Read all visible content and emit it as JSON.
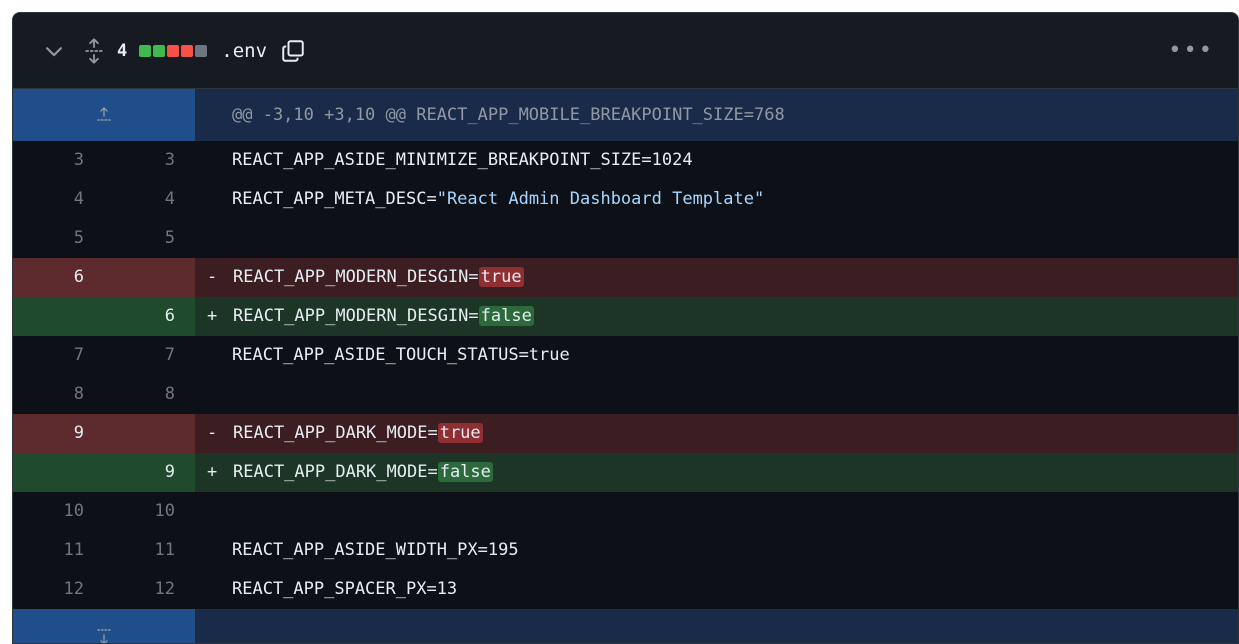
{
  "header": {
    "changes_count": "4",
    "filename": ".env",
    "more_label": "•••",
    "bars": [
      "#3fb950",
      "#3fb950",
      "#f85149",
      "#f85149",
      "#6e7681"
    ]
  },
  "hunk_top": {
    "text": "@@ -3,10 +3,10 @@ REACT_APP_MOBILE_BREAKPOINT_SIZE=768"
  },
  "lines": [
    {
      "type": "ctx",
      "old": "3",
      "new": "3",
      "text": "REACT_APP_ASIDE_MINIMIZE_BREAKPOINT_SIZE=1024"
    },
    {
      "type": "ctx",
      "old": "4",
      "new": "4",
      "text_prefix": "REACT_APP_META_DESC=",
      "text_string": "\"React Admin Dashboard Template\""
    },
    {
      "type": "ctx",
      "old": "5",
      "new": "5",
      "text": ""
    },
    {
      "type": "del",
      "old": "6",
      "new": "",
      "marker": "-",
      "text_prefix": "REACT_APP_MODERN_DESGIN=",
      "text_hl": "true"
    },
    {
      "type": "add",
      "old": "",
      "new": "6",
      "marker": "+",
      "text_prefix": "REACT_APP_MODERN_DESGIN=",
      "text_hl": "false"
    },
    {
      "type": "ctx",
      "old": "7",
      "new": "7",
      "text": "REACT_APP_ASIDE_TOUCH_STATUS=true"
    },
    {
      "type": "ctx",
      "old": "8",
      "new": "8",
      "text": ""
    },
    {
      "type": "del",
      "old": "9",
      "new": "",
      "marker": "-",
      "text_prefix": "REACT_APP_DARK_MODE=",
      "text_hl": "true"
    },
    {
      "type": "add",
      "old": "",
      "new": "9",
      "marker": "+",
      "text_prefix": "REACT_APP_DARK_MODE=",
      "text_hl": "false"
    },
    {
      "type": "ctx",
      "old": "10",
      "new": "10",
      "text": ""
    },
    {
      "type": "ctx",
      "old": "11",
      "new": "11",
      "text": "REACT_APP_ASIDE_WIDTH_PX=195"
    },
    {
      "type": "ctx",
      "old": "12",
      "new": "12",
      "text": "REACT_APP_SPACER_PX=13"
    }
  ]
}
